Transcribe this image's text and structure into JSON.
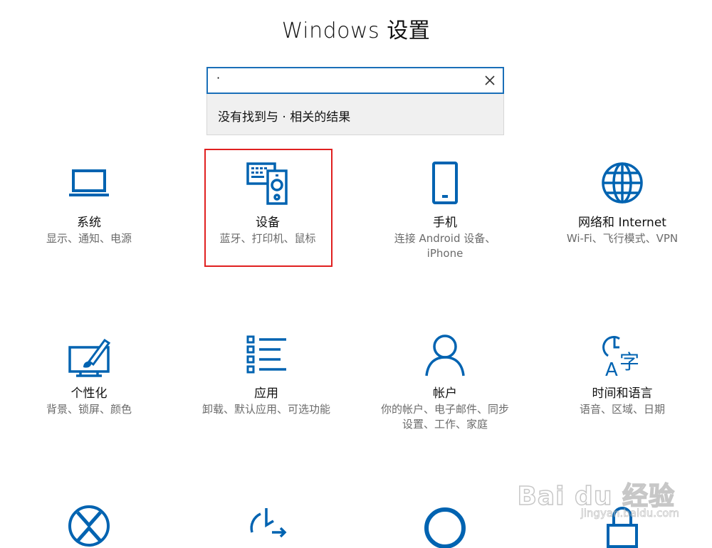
{
  "window": {
    "title": "Windows 设置"
  },
  "search": {
    "value": "·",
    "no_results": "没有找到与 · 相关的结果"
  },
  "tiles": [
    {
      "name": "系统",
      "desc": "显示、通知、电源",
      "icon": "laptop-icon"
    },
    {
      "name": "设备",
      "desc": "蓝牙、打印机、鼠标",
      "icon": "devices-icon"
    },
    {
      "name": "手机",
      "desc": "连接 Android 设备、",
      "desc2": "iPhone",
      "icon": "phone-icon"
    },
    {
      "name": "网络和 Internet",
      "desc": "Wi-Fi、飞行模式、VPN",
      "icon": "globe-icon"
    },
    {
      "name": "个性化",
      "desc": "背景、锁屏、颜色",
      "icon": "personalization-icon"
    },
    {
      "name": "应用",
      "desc": "卸载、默认应用、可选功能",
      "icon": "apps-list-icon"
    },
    {
      "name": "帐户",
      "desc": "你的帐户、电子邮件、同步",
      "desc2": "设置、工作、家庭",
      "icon": "account-icon"
    },
    {
      "name": "时间和语言",
      "desc": "语音、区域、日期",
      "icon": "time-language-icon"
    }
  ],
  "watermark": {
    "main": "Bai du 经验",
    "sub": "jingyan.baidu.com"
  },
  "colors": {
    "accent": "#0063b1",
    "highlight": "#e02020",
    "search_border": "#1a6fb8"
  }
}
